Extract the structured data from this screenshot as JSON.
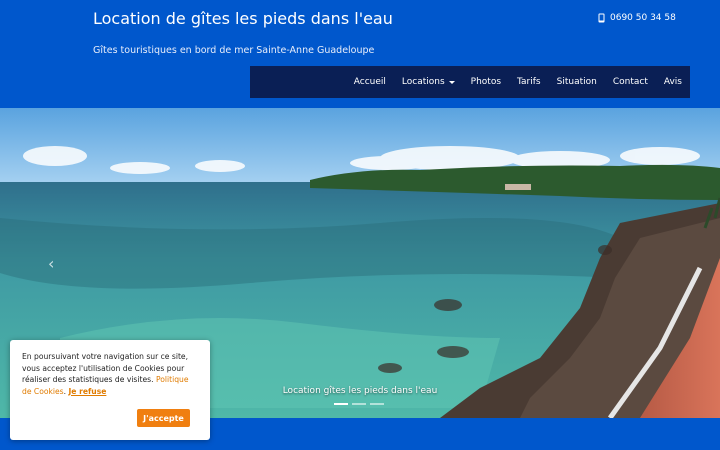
{
  "header": {
    "site_title": "Location de gîtes les pieds dans l'eau",
    "phone": "0690 50 34 58",
    "phone_icon": "mobile-phone-icon",
    "tagline": "Gîtes touristiques en bord de mer Sainte-Anne Guadeloupe"
  },
  "nav": {
    "items": [
      {
        "label": "Accueil"
      },
      {
        "label": "Locations",
        "has_dropdown": true
      },
      {
        "label": "Photos"
      },
      {
        "label": "Tarifs"
      },
      {
        "label": "Situation"
      },
      {
        "label": "Contact"
      },
      {
        "label": "Avis"
      }
    ]
  },
  "carousel": {
    "caption": "Location gîtes les pieds dans l'eau",
    "prev_icon": "chevron-left-icon",
    "slides_count": 3,
    "active_slide": 1
  },
  "cookie_banner": {
    "text_before": "En poursuivant votre navigation sur ce site, vous acceptez l'utilisation de Cookies pour réaliser des statistiques de visites. ",
    "policy_link": "Politique de Cookies",
    "separator": ". ",
    "refuse_link": "Je refuse",
    "accept_label": "J'accepte"
  },
  "colors": {
    "page_bg": "#0057cc",
    "nav_bg": "#0a1f55",
    "accent_orange": "#f07f10"
  }
}
